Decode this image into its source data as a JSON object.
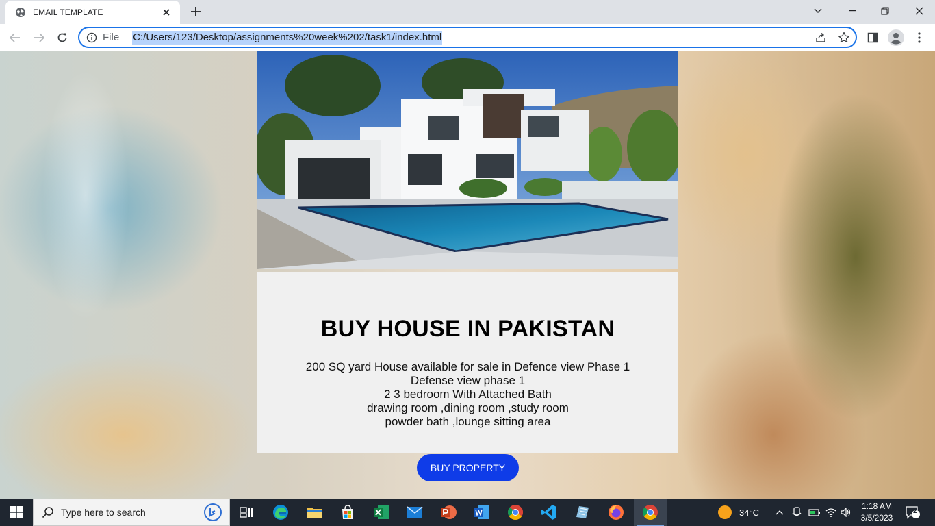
{
  "browser": {
    "tab_title": "EMAIL TEMPLATE",
    "address": {
      "scheme_label": "File",
      "url": "C:/Users/123/Desktop/assignments%20week%202/task1/index.html"
    }
  },
  "page": {
    "heading": "BUY HOUSE IN PAKISTAN",
    "description_lines": [
      "200 SQ yard House available for sale in Defence view Phase 1",
      "Defense view phase 1",
      "2 3 bedroom With Attached Bath",
      "drawing room ,dining room ,study room",
      "powder bath ,lounge sitting area"
    ],
    "button_label": "BUY PROPERTY",
    "button_color": "#0f3ce8"
  },
  "taskbar": {
    "search_placeholder": "Type here to search",
    "weather": "34°C",
    "time": "1:18 AM",
    "date": "3/5/2023",
    "notification_count": "2"
  }
}
